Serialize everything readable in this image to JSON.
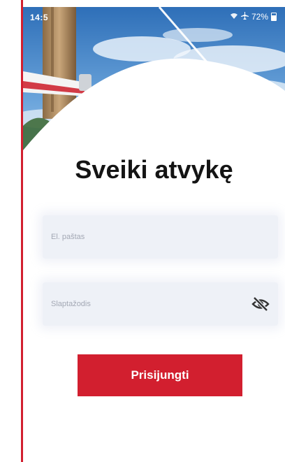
{
  "status_bar": {
    "time": "14:5",
    "battery": "72%"
  },
  "login": {
    "title": "Sveiki atvykę",
    "email_placeholder": "El. paštas",
    "password_placeholder": "Slaptažodis",
    "submit_label": "Prisijungti"
  },
  "colors": {
    "accent": "#d21f2f",
    "field_background": "#eef1f7",
    "title_text": "#141414",
    "placeholder_text": "#a3a8b4"
  },
  "icons": {
    "hero": "sky-and-utility-pole-photo",
    "wifi": "wifi-icon",
    "airplane": "airplane-mode-icon",
    "battery": "battery-icon",
    "password_toggle": "eye-off-icon"
  }
}
